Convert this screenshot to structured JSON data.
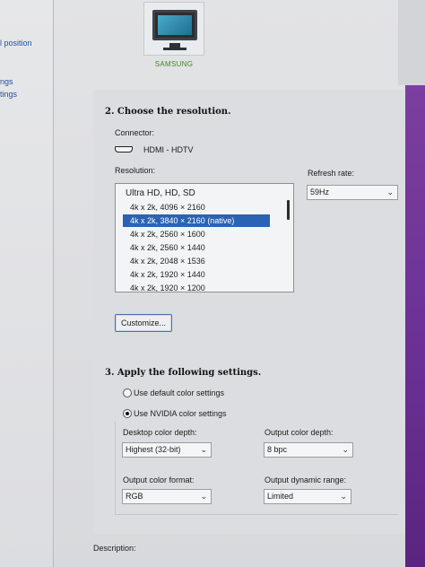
{
  "nav": {
    "item1": "l position",
    "item2": "ngs",
    "item3": "tings"
  },
  "monitor": {
    "name": "SAMSUNG"
  },
  "resolution_section": {
    "title": "2. Choose the resolution.",
    "connector_label": "Connector:",
    "connector_value": "HDMI - HDTV",
    "resolution_label": "Resolution:",
    "refresh_label": "Refresh rate:",
    "refresh_value": "59Hz",
    "group": "Ultra HD, HD, SD",
    "rows": [
      "4k x 2k, 4096 × 2160",
      "4k x 2k, 3840 × 2160 (native)",
      "4k x 2k, 2560 × 1600",
      "4k x 2k, 2560 × 1440",
      "4k x 2k, 2048 × 1536",
      "4k x 2k, 1920 × 1440",
      "4k x 2k, 1920 × 1200"
    ],
    "selected_index": 1,
    "customize_label": "Customize..."
  },
  "settings_section": {
    "title": "3. Apply the following settings.",
    "option_default": "Use default color settings",
    "option_nvidia": "Use NVIDIA color settings",
    "selected_option": "Use NVIDIA color settings",
    "desktop_depth_label": "Desktop color depth:",
    "desktop_depth_value": "Highest (32-bit)",
    "output_depth_label": "Output color depth:",
    "output_depth_value": "8 bpc",
    "output_format_label": "Output color format:",
    "output_format_value": "RGB",
    "output_range_label": "Output dynamic range:",
    "output_range_value": "Limited"
  },
  "description_label": "Description:",
  "colors": {
    "selection": "#2a63b4",
    "accent_strip": "#6a2f93",
    "nav_link": "#1f4f9e",
    "monitor_label": "#3e8a2e"
  },
  "icons": {
    "monitor": "monitor-icon",
    "connector": "hdmi-connector-icon",
    "dropdown": "chevron-down-icon"
  }
}
